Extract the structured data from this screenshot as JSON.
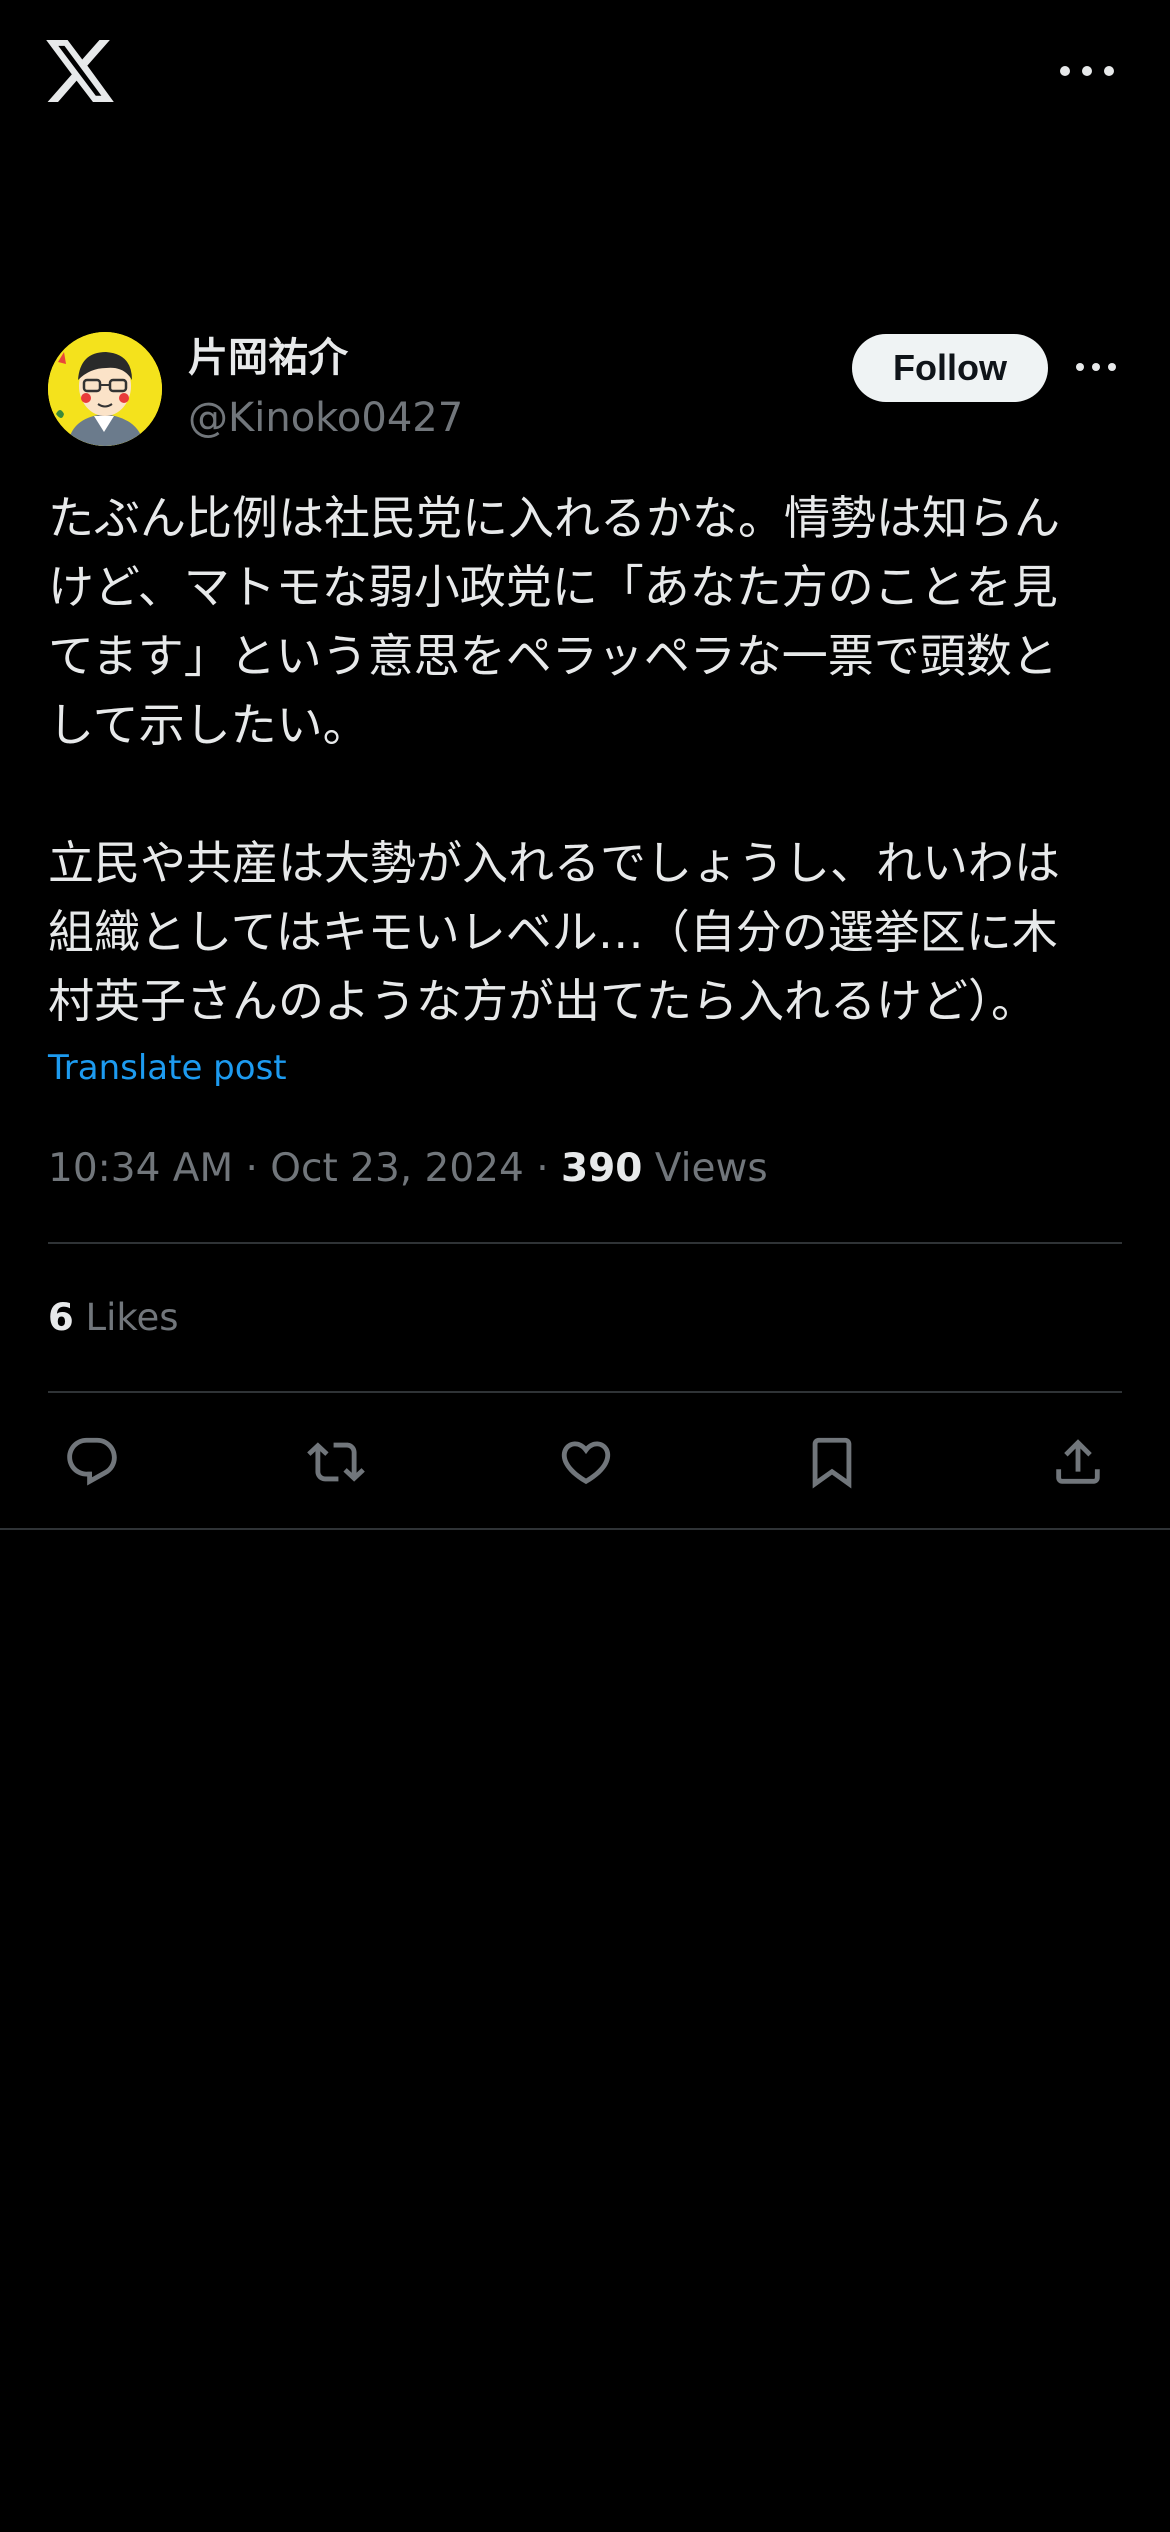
{
  "top_bar": {
    "logo_icon": "x-logo-icon",
    "more_icon": "more-horizontal-icon"
  },
  "author": {
    "display_name": "片岡祐介",
    "handle": "@Kinoko0427",
    "follow_label": "Follow"
  },
  "post": {
    "text": "たぶん比例は社民党に入れるかな。情勢は知らん\nけど、マトモな弱小政党に「あなた方のことを見\nてます」という意思をペラッペラな一票で頭数と\nして示したい。\n\n立民や共産は大勢が入れるでしょうし、れいわは\n組織としてはキモいレベル…（自分の選挙区に木\n村英子さんのような方が出てたら入れるけど）。",
    "translate_label": "Translate post",
    "timestamp": "10:34 AM · Oct 23, 2024 · ",
    "views_count": "390",
    "views_label": " Views"
  },
  "stats": {
    "likes_count": "6",
    "likes_label": " Likes"
  },
  "actions": {
    "reply_icon": "reply-icon",
    "repost_icon": "repost-icon",
    "like_icon": "heart-icon",
    "bookmark_icon": "bookmark-icon",
    "share_icon": "share-icon"
  },
  "colors": {
    "background": "#000000",
    "text": "#e7e9ea",
    "secondary": "#71767b",
    "link": "#1d9bf0",
    "divider": "#2f3336",
    "follow_bg": "#eff3f4"
  }
}
